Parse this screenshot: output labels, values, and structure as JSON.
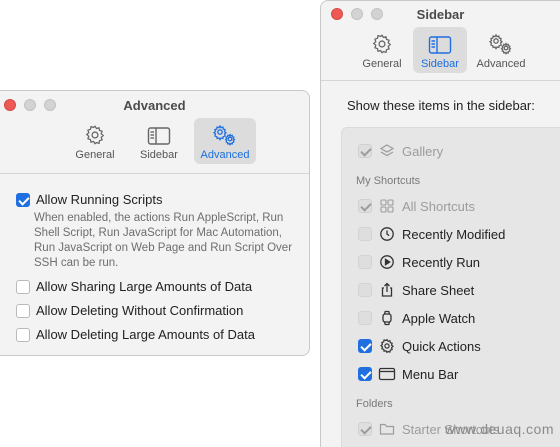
{
  "advanced_window": {
    "title": "Advanced",
    "tabs": [
      {
        "label": "General",
        "icon": "gear-icon",
        "active": false
      },
      {
        "label": "Sidebar",
        "icon": "sidebar-icon",
        "active": false
      },
      {
        "label": "Advanced",
        "icon": "gears-icon",
        "active": true
      }
    ],
    "options": [
      {
        "label": "Allow Running Scripts",
        "checked": true
      },
      {
        "label": "Allow Sharing Large Amounts of Data",
        "checked": false
      },
      {
        "label": "Allow Deleting Without Confirmation",
        "checked": false
      },
      {
        "label": "Allow Deleting Large Amounts of Data",
        "checked": false
      }
    ],
    "running_scripts_description": "When enabled, the actions Run AppleScript, Run Shell Script, Run JavaScript for Mac Automation, Run JavaScript on Web Page and Run Script Over SSH can be run."
  },
  "sidebar_window": {
    "title": "Sidebar",
    "tabs": [
      {
        "label": "General",
        "icon": "gear-icon",
        "active": false
      },
      {
        "label": "Sidebar",
        "icon": "sidebar-icon",
        "active": true
      },
      {
        "label": "Advanced",
        "icon": "gears-icon",
        "active": false
      }
    ],
    "heading": "Show these items in the sidebar:",
    "gallery": {
      "label": "Gallery",
      "checked": true,
      "disabled": true,
      "icon": "layers-icon"
    },
    "my_shortcuts_section": "My Shortcuts",
    "items": [
      {
        "label": "All Shortcuts",
        "checked": true,
        "disabled": true,
        "icon": "grid-icon"
      },
      {
        "label": "Recently Modified",
        "checked": false,
        "disabled": false,
        "icon": "clock-icon"
      },
      {
        "label": "Recently Run",
        "checked": false,
        "disabled": false,
        "icon": "play-circle-icon"
      },
      {
        "label": "Share Sheet",
        "checked": false,
        "disabled": false,
        "icon": "share-icon"
      },
      {
        "label": "Apple Watch",
        "checked": false,
        "disabled": false,
        "icon": "watch-icon"
      },
      {
        "label": "Quick Actions",
        "checked": true,
        "disabled": false,
        "icon": "gear-icon"
      },
      {
        "label": "Menu Bar",
        "checked": true,
        "disabled": false,
        "icon": "menu-bar-icon"
      }
    ],
    "folders_section": "Folders",
    "folder_item": {
      "label": "Starter Shortcuts",
      "checked": true,
      "disabled": true,
      "icon": "folder-icon"
    }
  },
  "watermark": "www.deuaq.com",
  "colors": {
    "accent": "#1f6fe0",
    "close_button": "#ed5a55",
    "window_bg": "#f3f3f3"
  }
}
